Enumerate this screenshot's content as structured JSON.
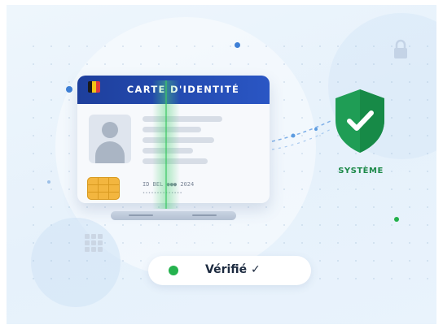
{
  "card": {
    "title": "CARTE D'IDENTITÉ",
    "code": "ID BEL ●●● 2024",
    "code_line2": "••••••••••••••",
    "flag_colors": [
      "#1a1a1a",
      "#f4c514",
      "#e03a3e"
    ]
  },
  "system": {
    "label": "SYSTÈME",
    "shield_color": "#1f9d55",
    "icon": "shield-check-icon"
  },
  "status": {
    "text": "Vérifié ✓",
    "dot_color": "#25b24e"
  },
  "icons": [
    "lock-icon",
    "grid-icon",
    "person-silhouette-icon",
    "chip-icon"
  ],
  "colors": {
    "header_blue": "#1e3f9c",
    "scan_green": "#50d278",
    "accent_blue": "#3b82f6",
    "background": "#eaf4fc"
  }
}
